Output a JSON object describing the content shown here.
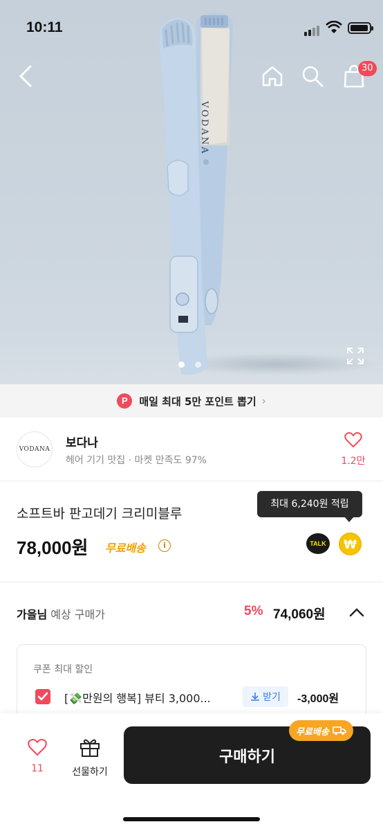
{
  "status_bar": {
    "time": "10:11"
  },
  "header": {
    "cart_count": "30"
  },
  "hero": {
    "brand_text": "VODANA",
    "slide_count": 2,
    "active_slide": 1
  },
  "promo": {
    "icon_letter": "P",
    "text": "매일 최대 5만 포인트 뽑기"
  },
  "seller": {
    "logo_text": "VODANA",
    "name": "보다나",
    "description": "헤어 기기 맛집 · 마켓 만족도 97%",
    "likes": "1.2만"
  },
  "product": {
    "name": "소프트바 판고데기 크리미블루",
    "price": "78,000원",
    "free_shipping": "무료배송",
    "tooltip": "최대 6,240원 적립",
    "talk_label": "TALK",
    "won_symbol": "₩"
  },
  "expected": {
    "user": "가을님",
    "label": "예상 구매가",
    "discount": "5%",
    "final_price": "74,060원"
  },
  "coupon": {
    "title": "쿠폰 최대 할인",
    "name": "[💸만원의 행복] 뷰티 3,000...",
    "get_label": "받기",
    "amount": "-3,000원"
  },
  "bottom_bar": {
    "like_count": "11",
    "gift_label": "선물하기",
    "buy_label": "구매하기",
    "buy_badge": "무료배송"
  },
  "colors": {
    "accent": "#f04a5b",
    "shipping": "#f4a100",
    "buy_button": "#1e1e1e"
  }
}
